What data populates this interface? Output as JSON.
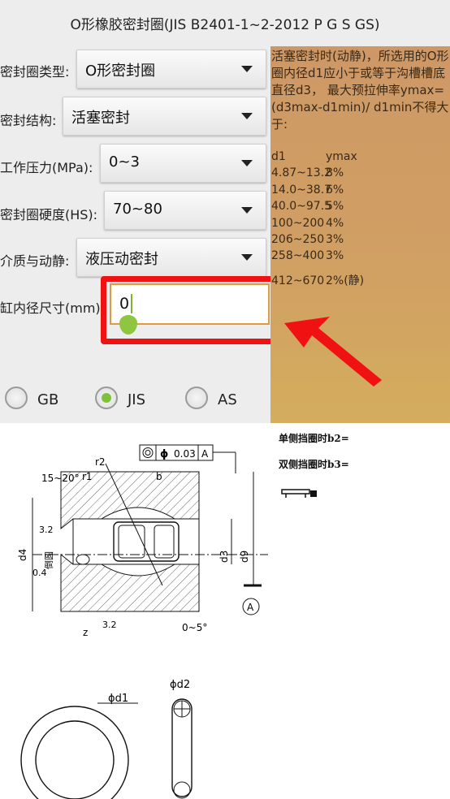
{
  "title": "O形橡胶密封圈(JIS B2401-1~2-2012 P G S GS)",
  "form": {
    "rows": [
      {
        "label": "密封圈类型:",
        "value": "O形密封圈"
      },
      {
        "label": "密封结构:",
        "value": "活塞密封"
      },
      {
        "label": "工作压力(MPa):",
        "value": "0~3"
      },
      {
        "label": "密封圈硬度(HS):",
        "value": "70~80"
      },
      {
        "label": "介质与动静:",
        "value": "液压动密封"
      }
    ],
    "bore_label": "缸内径尺寸(mm):",
    "bore_value": "0"
  },
  "info": {
    "text": "活塞密封时(动静)，所选用的O形圈内径d1应小于或等于沟槽槽底直径d3， 最大预拉伸率ymax=(d3max-d1min)/ d1min不得大于:",
    "header": [
      "d1",
      "ymax"
    ],
    "rows": [
      [
        "4.87~13.2",
        "8%"
      ],
      [
        "14.0~38.7",
        "6%"
      ],
      [
        "40.0~97.5",
        "5%"
      ],
      [
        "100~200",
        "4%"
      ],
      [
        "206~250",
        "3%"
      ],
      [
        "258~400",
        "3%"
      ],
      [
        "412~670",
        "2%(静)"
      ]
    ]
  },
  "standards": {
    "options": [
      {
        "label": "GB",
        "selected": false
      },
      {
        "label": "JIS",
        "selected": true
      },
      {
        "label": "AS",
        "selected": false
      }
    ]
  },
  "results": {
    "single_ring": "单侧挡圈时b2=",
    "double_ring": "双侧挡圈时b3="
  },
  "drawing": {
    "tolerance": {
      "symbol": "◎",
      "phi": "ϕ",
      "value": "0.03",
      "datum": "A"
    },
    "labels": {
      "r2": "r2",
      "r1": "r1",
      "b": "b",
      "angle": "15~20°",
      "rough1": "3.2",
      "rough2": "0.4",
      "rough3": "3.2",
      "chamfer": "倒圆",
      "d4": "d4",
      "d3": "d3",
      "d9": "d9",
      "z": "z",
      "datum": "A",
      "angle2": "0~5°",
      "od_d1": "ϕd1",
      "od_d2": "ϕd2"
    }
  },
  "colors": {
    "accent": "#7fc13d",
    "highlight": "#f01212",
    "info_bg": "#cd9866",
    "input_border": "#e39a3c"
  }
}
